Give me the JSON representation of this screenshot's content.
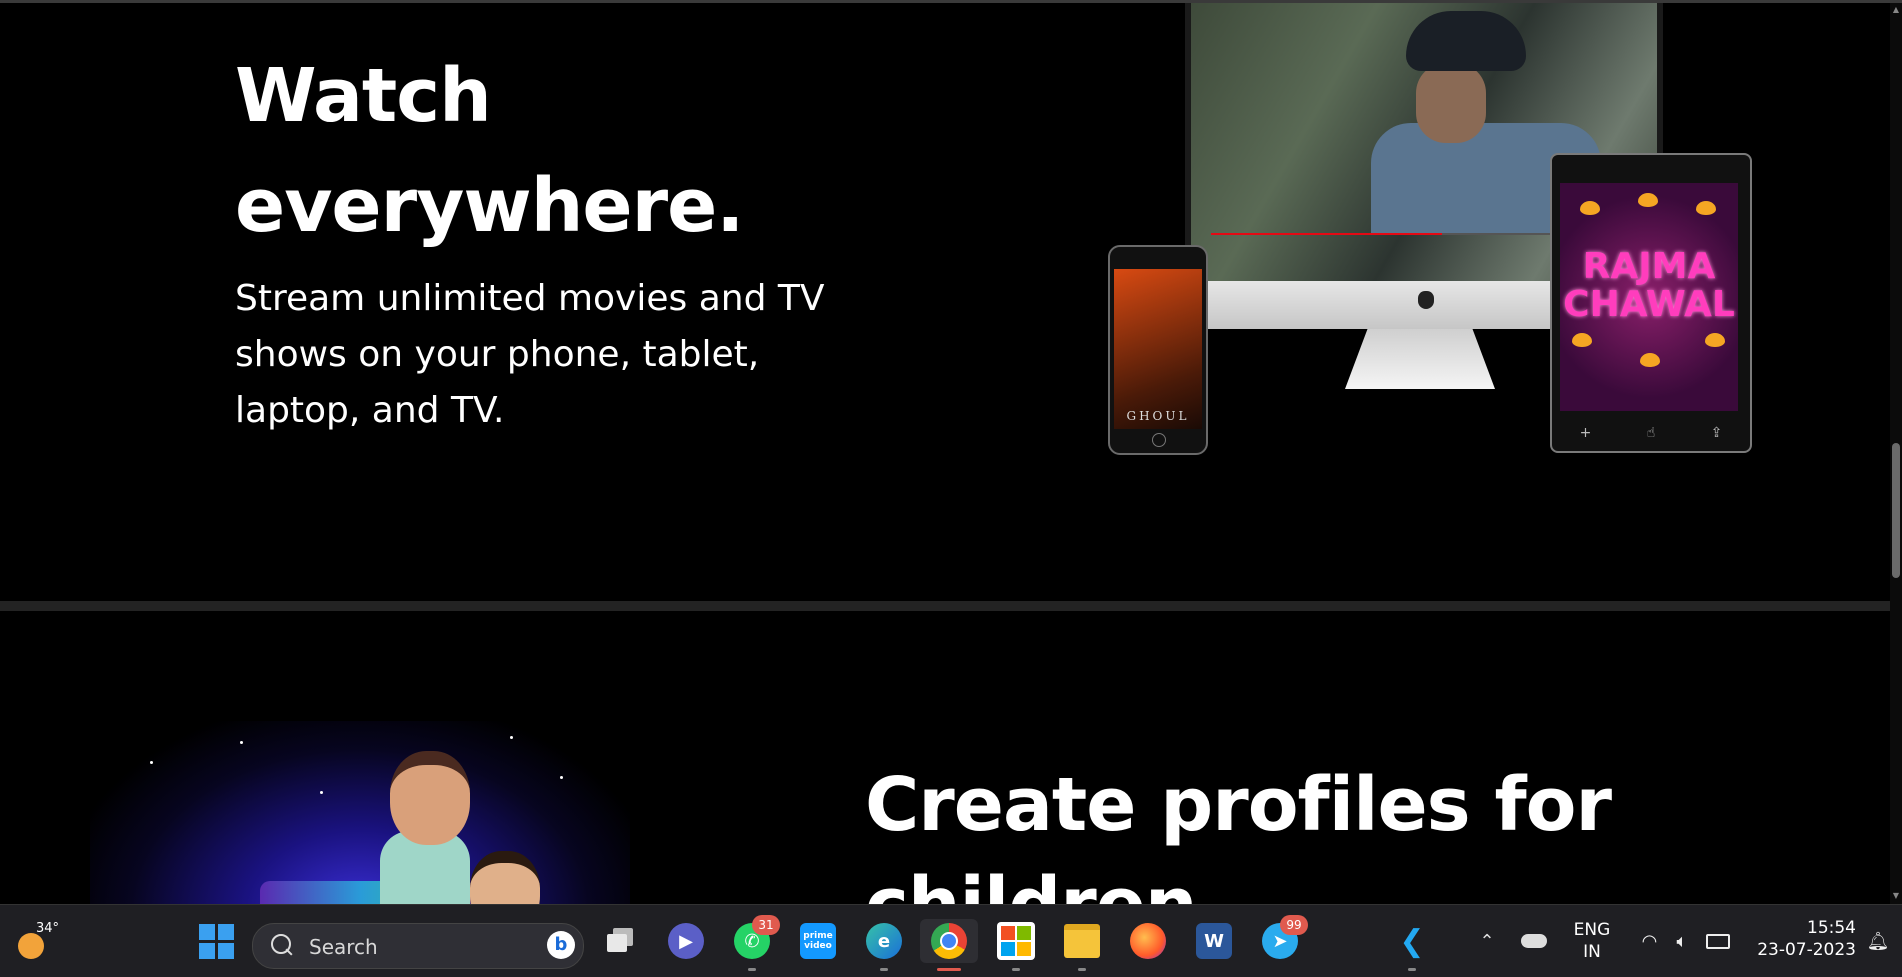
{
  "section1": {
    "heading_line1": "Watch",
    "heading_line2": "everywhere.",
    "description_line1": "Stream unlimited movies and TV",
    "description_line2": "shows on your phone, tablet,",
    "description_line3": "laptop, and TV.",
    "phone_poster_title": "GHOUL",
    "tablet_poster_title_line1": "RAJMA",
    "tablet_poster_title_line2": "CHAWAL"
  },
  "section2": {
    "heading_line1": "Create profiles for",
    "heading_line2": "children."
  },
  "taskbar": {
    "weather_temp": "34°",
    "search_label": "Search",
    "whatsapp_badge": "31",
    "telegram_badge": "99",
    "prime_label_line1": "prime",
    "prime_label_line2": "video",
    "language_line1": "ENG",
    "language_line2": "IN",
    "time": "15:54",
    "date": "23-07-2023"
  },
  "colors": {
    "background": "#000000",
    "taskbar": "#1f1f23",
    "accent_red": "#e50914",
    "badge": "#e05a4e"
  }
}
